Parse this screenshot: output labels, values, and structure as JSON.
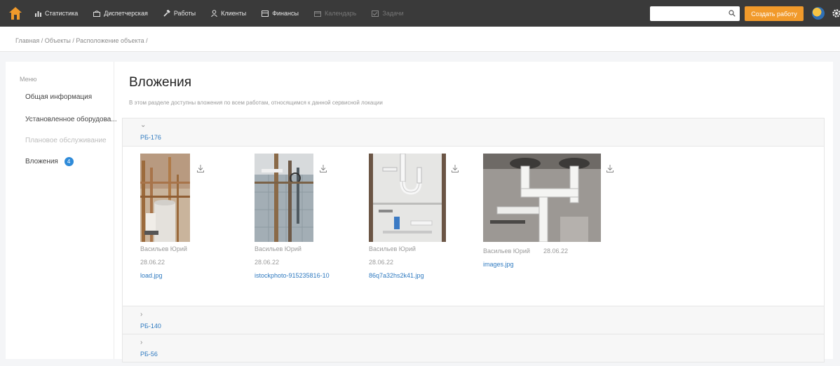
{
  "nav": {
    "items": [
      {
        "label": "Статистика",
        "icon": "chart-icon",
        "enabled": true
      },
      {
        "label": "Диспетчерская",
        "icon": "dispatch-icon",
        "enabled": true
      },
      {
        "label": "Работы",
        "icon": "hammer-icon",
        "enabled": true
      },
      {
        "label": "Клиенты",
        "icon": "user-icon",
        "enabled": true
      },
      {
        "label": "Финансы",
        "icon": "finance-icon",
        "enabled": true
      },
      {
        "label": "Календарь",
        "icon": "calendar-icon",
        "enabled": false
      },
      {
        "label": "Задачи",
        "icon": "tasks-icon",
        "enabled": false
      }
    ],
    "search_placeholder": "",
    "create_label": "Создать работу"
  },
  "breadcrumb": "Главная / Объекты / Расположение объекта /",
  "sidebar": {
    "title": "Меню",
    "items": [
      {
        "label": "Общая информация",
        "enabled": true
      },
      {
        "label": "Установленное оборудова...",
        "enabled": true
      },
      {
        "label": "Плановое обслуживание",
        "enabled": false
      },
      {
        "label": "Вложения",
        "enabled": true,
        "badge": "4"
      }
    ]
  },
  "main": {
    "title": "Вложения",
    "description": "В этом разделе доступны вложения по всем работам, относящимся к данной сервисной локации",
    "groups": [
      {
        "name": "РБ-176",
        "expanded": true,
        "chevron": "⌄",
        "attachments": [
          {
            "author": "Васильев Юрий",
            "date": "28.06.22",
            "file": "load.jpg"
          },
          {
            "author": "Васильев Юрий",
            "date": "28.06.22",
            "file": "istockphoto-915235816-10"
          },
          {
            "author": "Васильев Юрий",
            "date": "28.06.22",
            "file": "86q7a32hs2k41.jpg"
          },
          {
            "author": "Васильев Юрий",
            "date": "28.06.22",
            "file": "images.jpg"
          }
        ]
      },
      {
        "name": "РБ-140",
        "expanded": false,
        "chevron": "›"
      },
      {
        "name": "РБ-56",
        "expanded": false,
        "chevron": "›"
      }
    ]
  },
  "colors": {
    "topbar": "#3a3a3a",
    "accent": "#f19a2b",
    "link": "#2f7ac0",
    "badge": "#2f8bd9"
  }
}
